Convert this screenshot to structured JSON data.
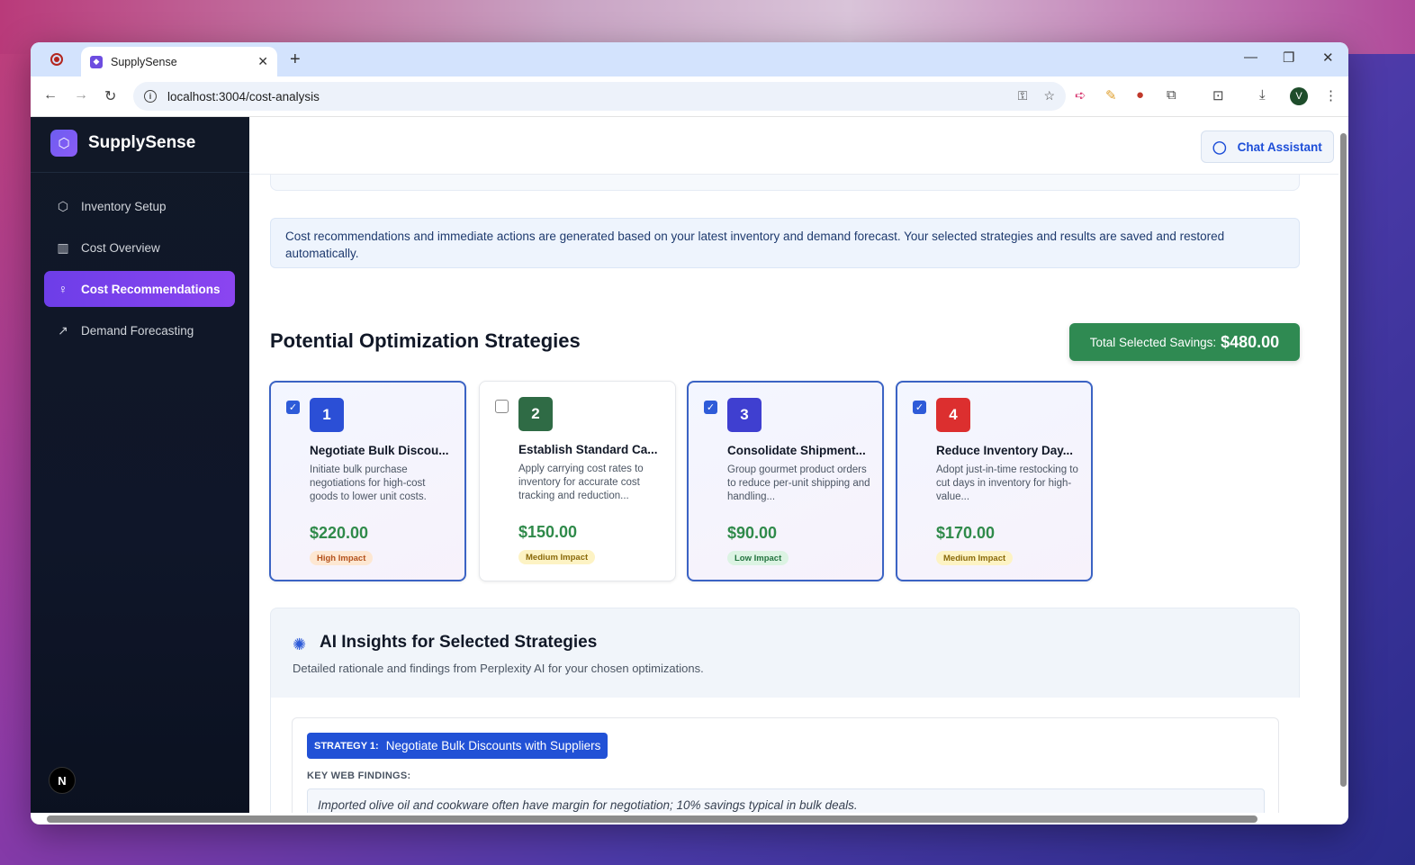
{
  "browser": {
    "tab_title": "SupplySense",
    "tab_close": "✕",
    "new_tab": "+",
    "url": "localhost:3004/cost-analysis",
    "window_controls": {
      "minimize": "—",
      "restore": "❐",
      "close": "✕"
    },
    "profile_initial": "V"
  },
  "sidebar": {
    "brand": "SupplySense",
    "items": [
      {
        "label": "Inventory Setup",
        "icon": "box-icon"
      },
      {
        "label": "Cost Overview",
        "icon": "bar-chart-icon"
      },
      {
        "label": "Cost Recommendations",
        "icon": "lightbulb-icon",
        "active": true
      },
      {
        "label": "Demand Forecasting",
        "icon": "trend-up-icon"
      }
    ],
    "footer_badge": "N"
  },
  "header": {
    "chat_button": "Chat Assistant"
  },
  "info_banner": "Cost recommendations and immediate actions are generated based on your latest inventory and demand forecast. Your selected strategies and results are saved and restored automatically.",
  "strategies": {
    "title": "Potential Optimization Strategies",
    "savings_label": "Total Selected Savings:",
    "savings_value": "$480.00",
    "cards": [
      {
        "num": "1",
        "title": "Negotiate Bulk Discou...",
        "desc": "Initiate bulk purchase negotiations for high-cost goods to lower unit costs.",
        "value": "$220.00",
        "impact": "High Impact",
        "checked": true,
        "color": "#2b4fd6"
      },
      {
        "num": "2",
        "title": "Establish Standard Ca...",
        "desc": "Apply carrying cost rates to inventory for accurate cost tracking and reduction...",
        "value": "$150.00",
        "impact": "Medium Impact",
        "checked": false,
        "color": "#2f6b45"
      },
      {
        "num": "3",
        "title": "Consolidate Shipment...",
        "desc": "Group gourmet product orders to reduce per-unit shipping and handling...",
        "value": "$90.00",
        "impact": "Low Impact",
        "checked": true,
        "color": "#3f3fd0"
      },
      {
        "num": "4",
        "title": "Reduce Inventory Day...",
        "desc": "Adopt just-in-time restocking to cut days in inventory for high-value...",
        "value": "$170.00",
        "impact": "Medium Impact",
        "checked": true,
        "color": "#dc2f2f"
      }
    ]
  },
  "ai_insights": {
    "title": "AI Insights for Selected Strategies",
    "subtitle": "Detailed rationale and findings from Perplexity AI for your chosen optimizations.",
    "strategy_tag": "STRATEGY 1:",
    "strategy_name": "Negotiate Bulk Discounts with Suppliers",
    "findings_label": "KEY WEB FINDINGS:",
    "finding": "Imported olive oil and cookware often have margin for negotiation; 10% savings typical in bulk deals."
  },
  "colors": {
    "sidebar_bg": "#111827",
    "active_nav": "#7c3aed",
    "savings_green": "#2f8a52",
    "high_impact_bg": "#fde7d2",
    "medium_impact_bg": "#fdf3c4",
    "low_impact_bg": "#dcf3e3"
  }
}
